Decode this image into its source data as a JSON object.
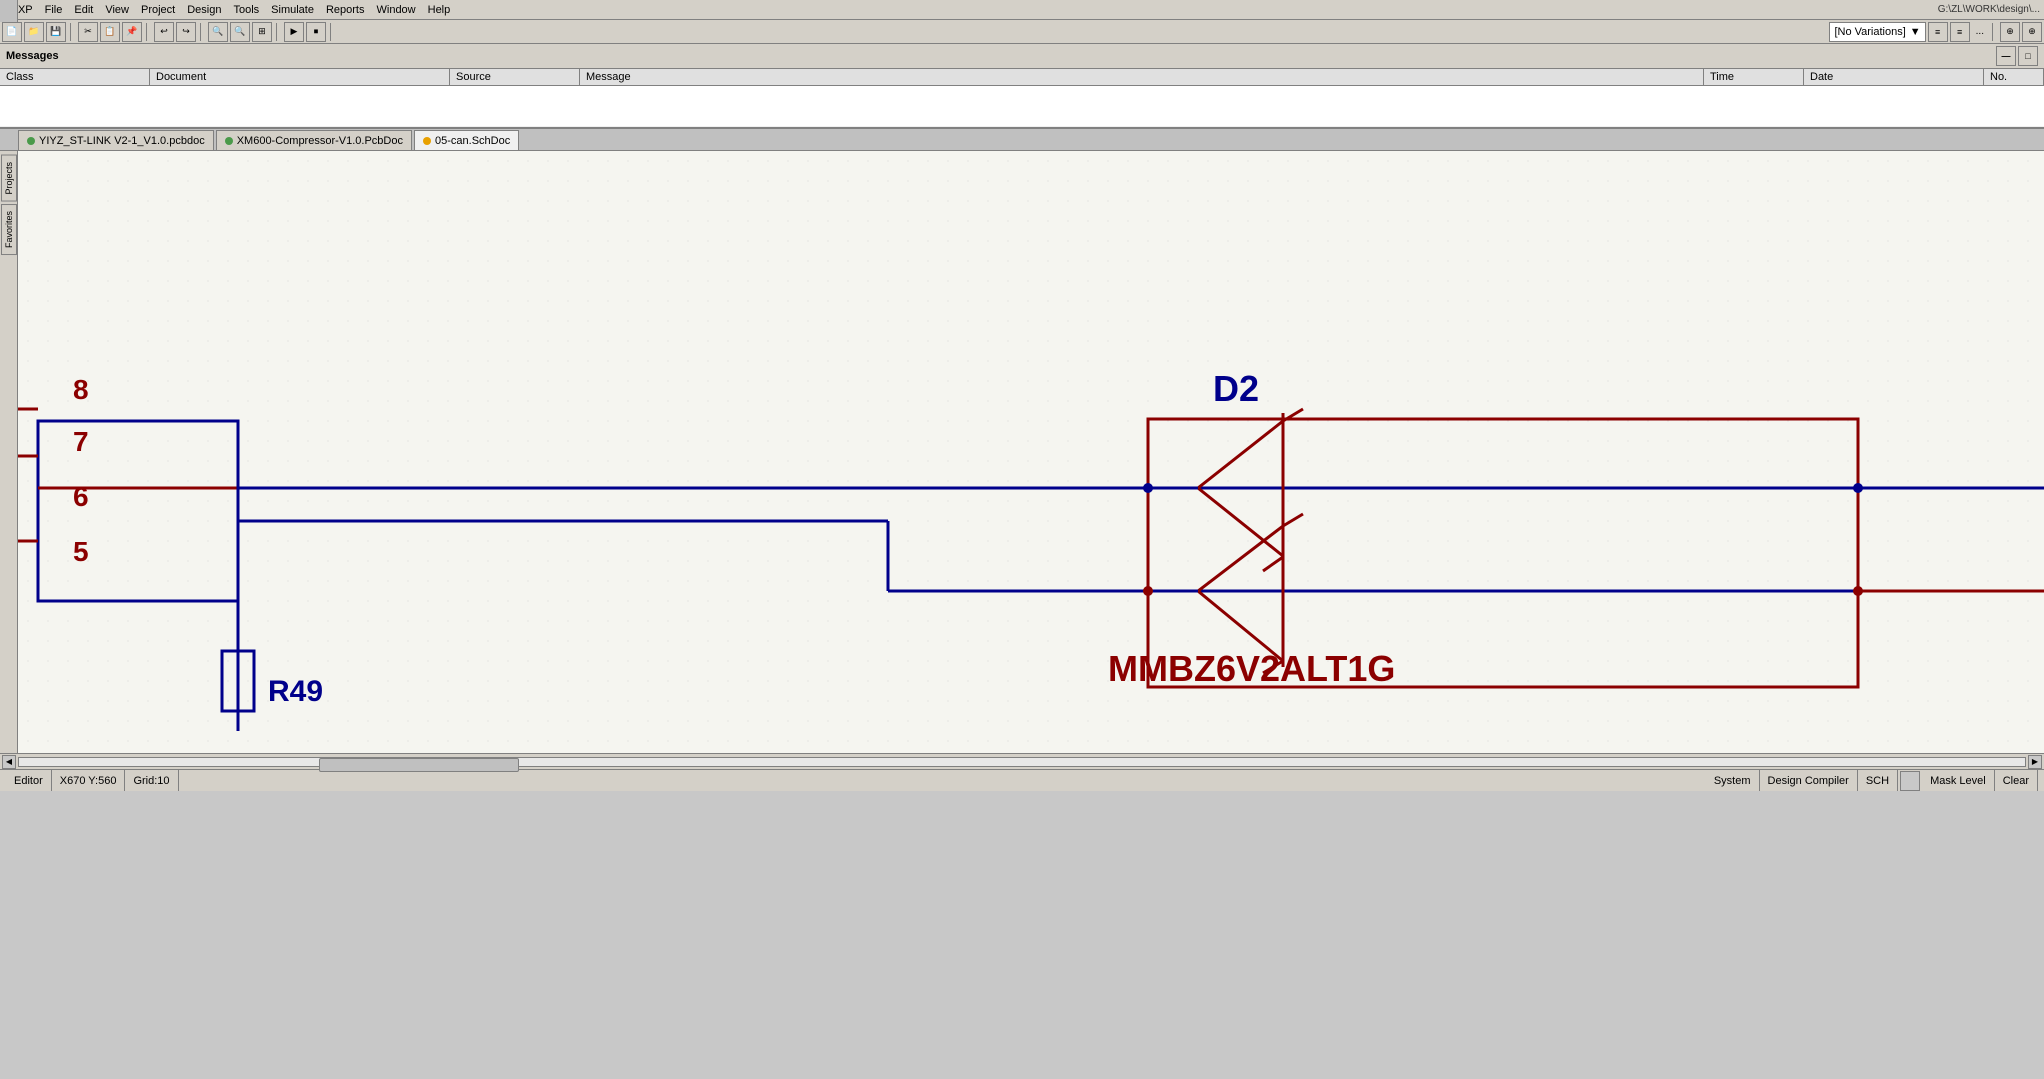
{
  "menu": {
    "items": [
      "DXP",
      "File",
      "Edit",
      "View",
      "Project",
      "Design",
      "Tools",
      "Simulate",
      "Reports",
      "Window",
      "Help"
    ]
  },
  "toolbar": {
    "variation_dropdown": "[No Variations]"
  },
  "messages": {
    "title": "Messages",
    "columns": [
      "Class",
      "Document",
      "Source",
      "Message",
      "Time",
      "Date",
      "No."
    ]
  },
  "tabs": [
    {
      "label": "YIYZ_ST-LINK V2-1_V1.0.pcbdoc",
      "color": "#4a9a4a",
      "active": false
    },
    {
      "label": "XM600-Compressor-V1.0.PcbDoc",
      "color": "#4a9a4a",
      "active": false
    },
    {
      "label": "05-can.SchDoc",
      "color": "#e8a000",
      "active": true
    }
  ],
  "schematic": {
    "pin_numbers": [
      "8",
      "7",
      "6",
      "5"
    ],
    "component_label": "D2",
    "component_part": "MMBZ6V2ALT1G",
    "resistor_label": "R49",
    "colors": {
      "dark_red": "#8b0000",
      "dark_blue": "#00008b",
      "medium_red": "#c00000"
    }
  },
  "status_bar": {
    "position": "X670 Y:560",
    "grid": "Grid:10",
    "editor": "Editor",
    "system": "System",
    "design_compiler": "Design Compiler",
    "sch": "SCH",
    "mask_level": "Mask Level",
    "clear": "Clear"
  },
  "sidebar": {
    "items": [
      "Projects",
      "Favorites"
    ]
  }
}
